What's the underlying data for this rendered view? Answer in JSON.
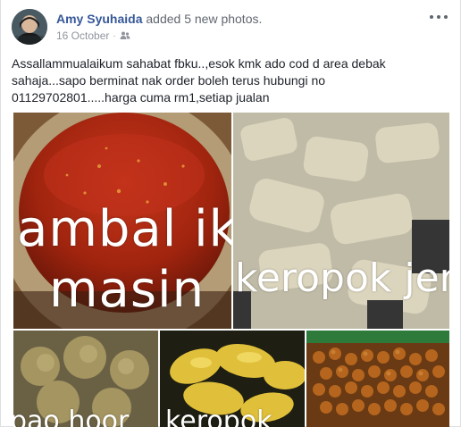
{
  "post": {
    "author": "Amy Syuhaida",
    "action": "added 5 new photos.",
    "date": "16 October",
    "separator": "·",
    "privacy_icon": "friends-icon",
    "more_icon": "more-options-icon",
    "text": "Assallammualaikum sahabat fbku..,esok kmk ado cod d area debak sahaja...sapo berminat nak order boleh terus hubungi no 01129702801.....harga cuma rm1,setiap jualan"
  },
  "photos": [
    {
      "overlay_lines": [
        "ambal ika",
        "masin"
      ]
    },
    {
      "overlay_lines": [
        "keropok jerin"
      ]
    },
    {
      "overlay_lines": [
        "pao hoor"
      ]
    },
    {
      "overlay_lines": [
        "keropok"
      ]
    },
    {
      "overlay_lines": []
    }
  ],
  "colors": {
    "author_link": "#365899",
    "meta_text": "#90949c",
    "body_text": "#1d2129"
  }
}
